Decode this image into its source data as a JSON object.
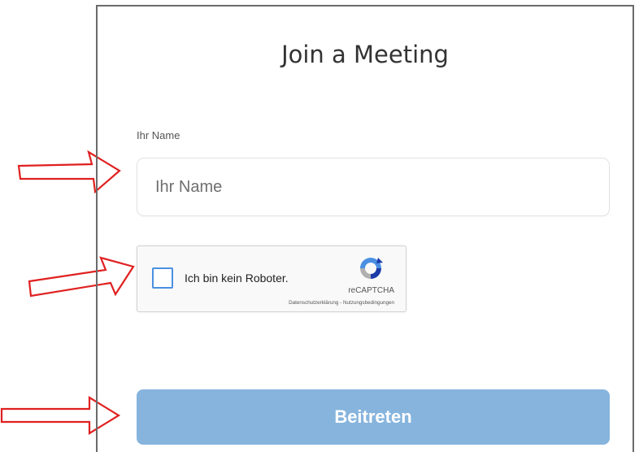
{
  "page": {
    "title": "Join a Meeting"
  },
  "form": {
    "name_label": "Ihr Name",
    "name_placeholder": "Ihr Name",
    "name_value": "",
    "recaptcha": {
      "checkbox_label": "Ich bin kein Roboter.",
      "brand": "reCAPTCHA",
      "links": "Datenschutzerklärung - Nutzungsbedingungen",
      "checked": false,
      "logo_icon": "recaptcha-logo-icon"
    },
    "join_button_label": "Beitreten"
  },
  "annotations": {
    "arrow_icon": "red-outline-arrow-right-icon",
    "arrow_color": "#e02020"
  },
  "colors": {
    "button_bg": "#86b4dd",
    "checkbox_border": "#4a90e2",
    "panel_border": "#6b6b6b"
  }
}
